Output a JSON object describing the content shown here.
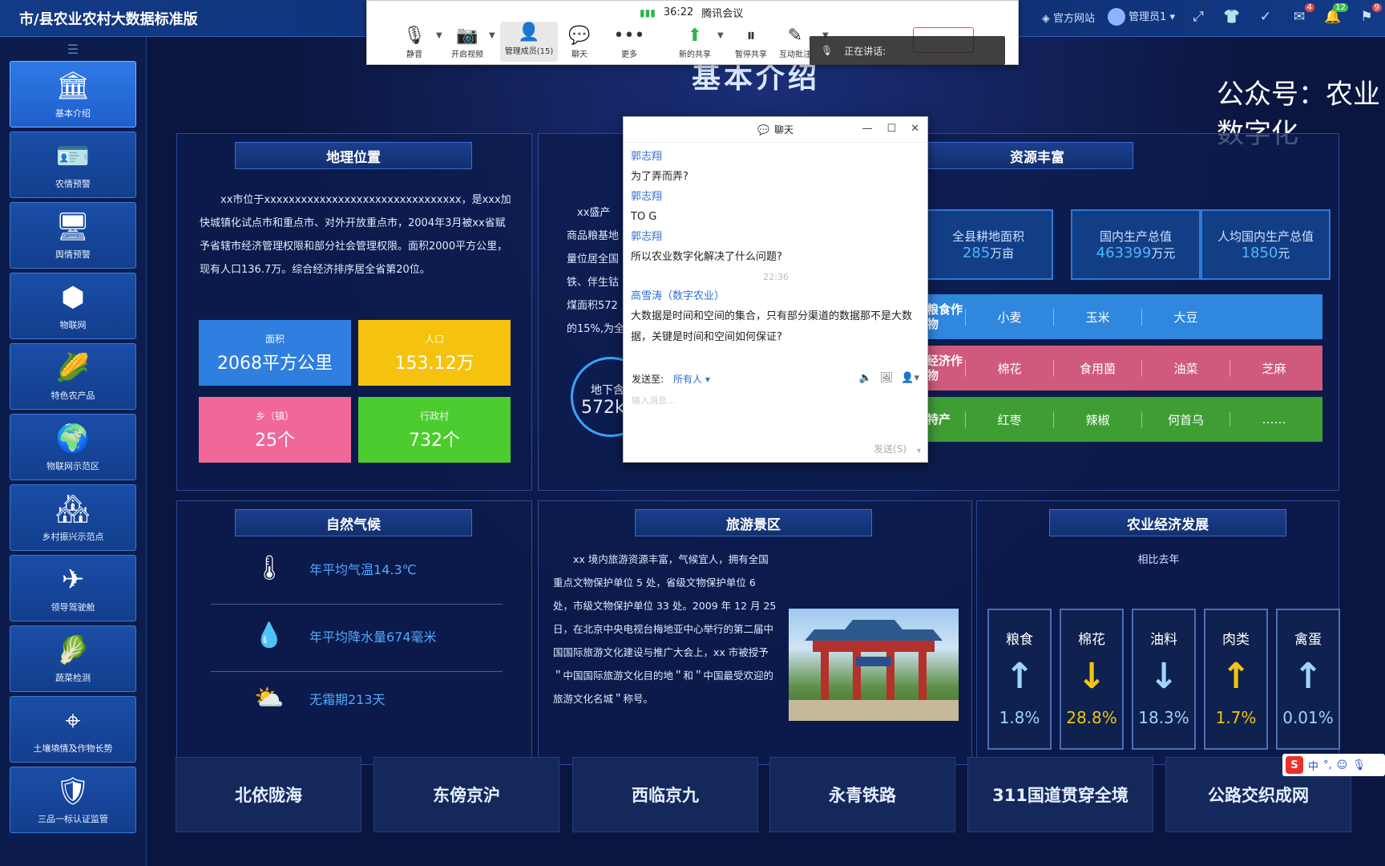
{
  "app": {
    "title": "市/县农业农村大数据标准版"
  },
  "header_right": {
    "official_site": "官方网站",
    "user": "管理员1",
    "badge_mail": "4",
    "badge_bell": "12",
    "badge_flag": "9"
  },
  "sidebar": {
    "items": [
      {
        "label": "基本介绍",
        "icon": "bank-icon"
      },
      {
        "label": "农情预警",
        "icon": "id-card-icon"
      },
      {
        "label": "舆情预警",
        "icon": "monitor-chart-icon"
      },
      {
        "label": "物联网",
        "icon": "hexagon-network-icon"
      },
      {
        "label": "特色农产品",
        "icon": "product-icon"
      },
      {
        "label": "物联网示范区",
        "icon": "globe-icon"
      },
      {
        "label": "乡村振兴示范点",
        "icon": "village-icon"
      },
      {
        "label": "领导驾驶舱",
        "icon": "plane-icon"
      },
      {
        "label": "蔬菜检测",
        "icon": "cabbage-icon"
      },
      {
        "label": "土壤墒情及作物长势",
        "icon": "target-icon"
      },
      {
        "label": "三品一标认证监管",
        "icon": "shield-check-icon"
      }
    ]
  },
  "page": {
    "title": "基本介绍",
    "watermark": "公众号：农业数字化"
  },
  "geo": {
    "title": "地理位置",
    "text": "xx市位于xxxxxxxxxxxxxxxxxxxxxxxxxxxxxxxx，是xxx加快城镇化试点市和重点市、对外开放重点市，2004年3月被xx省赋予省辖市经济管理权限和部分社会管理权限。面积2000平方公里，现有人口136.7万。综合经济排序居全省第20位。",
    "stats": [
      {
        "label": "面积",
        "value": "2068平方公里",
        "color": "#2f7fe0"
      },
      {
        "label": "人口",
        "value": "153.12万",
        "color": "#f5c30f"
      },
      {
        "label": "乡（镇）",
        "value": "25个",
        "color": "#f0689a"
      },
      {
        "label": "行政村",
        "value": "732个",
        "color": "#4ccc2e"
      }
    ]
  },
  "middle": {
    "lines": [
      "xx盛产",
      "商品粮基地",
      "量位居全国",
      "铁、伴生钴",
      "煤面积572",
      "的15%,为全"
    ],
    "ring_label": "地下含",
    "ring_value": "572k"
  },
  "resources": {
    "title": "资源丰富",
    "boxes": [
      {
        "label": "全县耕地面积",
        "value": "285",
        "unit": "万亩"
      },
      {
        "label": "国内生产总值",
        "value": "463399",
        "unit": "万元"
      },
      {
        "label": "人均国内生产总值",
        "value": "1850",
        "unit": "元"
      }
    ],
    "rows": [
      {
        "category": "粮食作物",
        "items": [
          "小麦",
          "玉米",
          "大豆",
          ""
        ],
        "color": "#2f87de"
      },
      {
        "category": "经济作物",
        "items": [
          "棉花",
          "食用菌",
          "油菜",
          "芝麻"
        ],
        "color": "#cf5a7c"
      },
      {
        "category": "特产",
        "items": [
          "红枣",
          "辣椒",
          "何首乌",
          "……"
        ],
        "color": "#3e9e34"
      }
    ]
  },
  "climate": {
    "title": "自然气候",
    "items": [
      {
        "icon": "thermometer-icon",
        "text": "年平均气温14.3℃"
      },
      {
        "icon": "raindrop-icon",
        "text": "年平均降水量674毫米"
      },
      {
        "icon": "sun-cloud-icon",
        "text": "无霜期213天"
      }
    ]
  },
  "tourism": {
    "title": "旅游景区",
    "text": "xx 境内旅游资源丰富，气候宜人，拥有全国重点文物保护单位 5 处，省级文物保护单位 6 处，市级文物保护单位 33 处。2009 年 12 月 25 日，在北京中央电视台梅地亚中心举行的第二届中国国际旅游文化建设与推广大会上，xx 市被授予＂中国国际旅游文化目的地＂和＂中国最受欢迎的旅游文化名城＂称号。"
  },
  "economy": {
    "title": "农业经济发展",
    "subtitle": "相比去年",
    "cards": [
      {
        "name": "粮食",
        "direction": "up",
        "value": "1.8%",
        "color": "#9fd4ff"
      },
      {
        "name": "棉花",
        "direction": "down",
        "value": "28.8%",
        "color": "#f5c30f"
      },
      {
        "name": "油料",
        "direction": "down",
        "value": "18.3%",
        "color": "#9fd4ff"
      },
      {
        "name": "肉类",
        "direction": "up",
        "value": "1.7%",
        "color": "#f5c30f"
      },
      {
        "name": "禽蛋",
        "direction": "up",
        "value": "0.01%",
        "color": "#9fd4ff"
      }
    ]
  },
  "routes": [
    "北依陇海",
    "东傍京沪",
    "西临京九",
    "永青铁路",
    "311国道贯穿全境",
    "公路交织成网"
  ],
  "meeting": {
    "time": "36:22",
    "app": "腾讯会议",
    "buttons": [
      {
        "label": "静音",
        "icon": "microphone-icon"
      },
      {
        "label": "开启视频",
        "icon": "video-off-icon"
      },
      {
        "label": "管理成员(15)",
        "icon": "member-icon"
      },
      {
        "label": "聊天",
        "icon": "chat-icon"
      },
      {
        "label": "更多",
        "icon": "more-icon"
      },
      {
        "label": "新的共享",
        "icon": "share-icon"
      },
      {
        "label": "暂停共享",
        "icon": "pause-icon"
      },
      {
        "label": "互动批注",
        "icon": "annotate-icon"
      }
    ],
    "speaking": "正在讲话:"
  },
  "chat": {
    "title": "聊天",
    "messages": [
      {
        "sender": "郭志翔",
        "text": "为了弄而弄?"
      },
      {
        "sender": "郭志翔",
        "text": "TO G"
      },
      {
        "sender": "郭志翔",
        "text": "所以农业数字化解决了什么问题?"
      }
    ],
    "time": "22:36",
    "reply_sender": "高雪涛（数字农业）",
    "reply_text": "大数据是时间和空间的集合，只有部分渠道的数据那不是大数据，关键是时间和空间如何保证?",
    "send_to_label": "发送至:",
    "send_to_value": "所有人",
    "input_placeholder": "输入消息...",
    "send_label": "发送(S)"
  },
  "ime": {
    "lang": "中"
  }
}
